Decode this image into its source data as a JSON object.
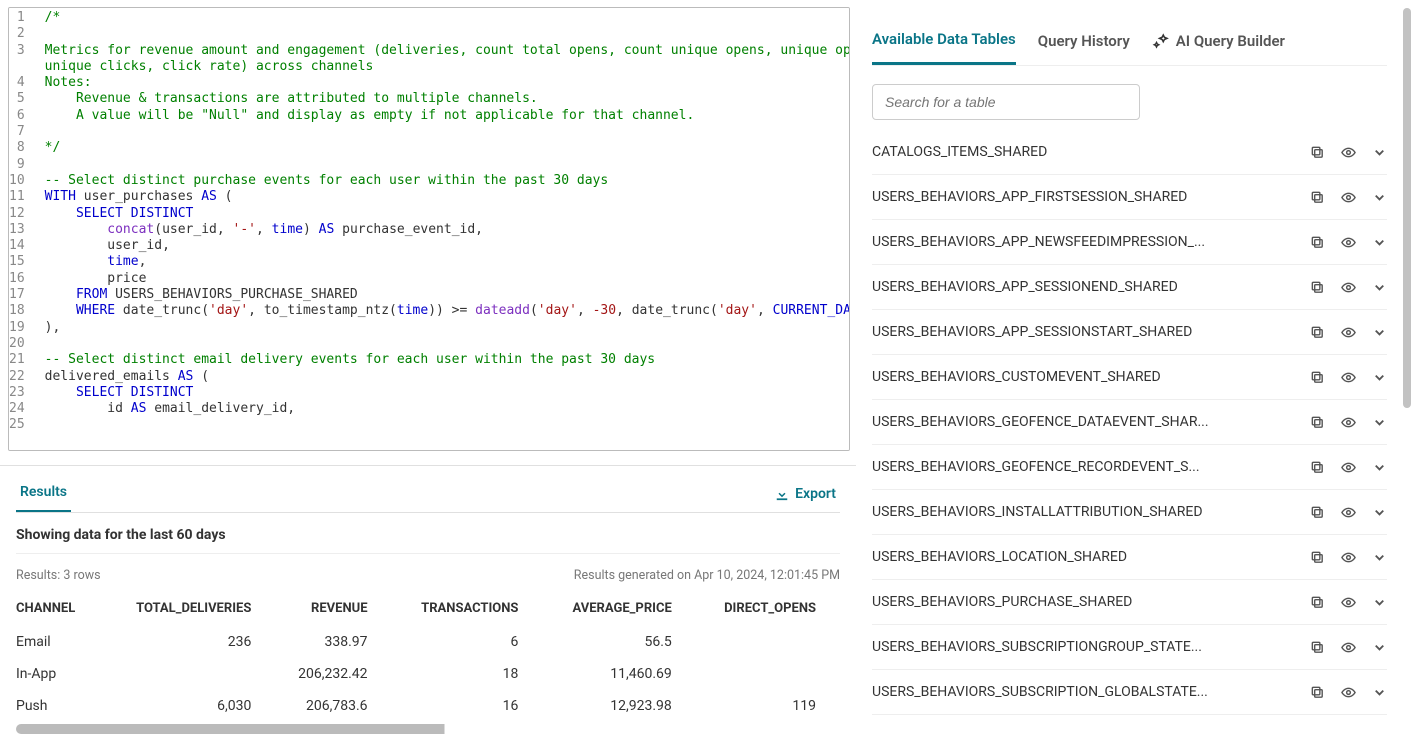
{
  "editor": {
    "lines": [
      {
        "n": 1,
        "segs": [
          {
            "t": "/*",
            "c": "c-comment"
          }
        ]
      },
      {
        "n": 2,
        "segs": []
      },
      {
        "n": 3,
        "segs": [
          {
            "t": "Metrics for revenue amount and engagement (deliveries, count total opens, count unique opens, unique open rate, count ",
            "c": "c-comment"
          }
        ]
      },
      {
        "n": 4,
        "indent": 0,
        "segs": [
          {
            "t": "unique clicks, click rate) across channels",
            "c": "c-comment"
          }
        ]
      },
      {
        "n": 5,
        "segs": [
          {
            "t": "Notes:",
            "c": "c-comment"
          }
        ]
      },
      {
        "n": 6,
        "indent": 1,
        "segs": [
          {
            "t": "Revenue & transactions are attributed to multiple channels.",
            "c": "c-comment"
          }
        ]
      },
      {
        "n": 7,
        "indent": 1,
        "segs": [
          {
            "t": "A value will be \"Null\" and display as empty if not applicable for that channel.",
            "c": "c-comment"
          }
        ]
      },
      {
        "n": 8,
        "segs": []
      },
      {
        "n": 9,
        "segs": [
          {
            "t": "*/",
            "c": "c-comment"
          }
        ]
      },
      {
        "n": 10,
        "segs": []
      },
      {
        "n": 11,
        "segs": [
          {
            "t": "-- Select distinct purchase events for each user within the past 30 days",
            "c": "c-comment"
          }
        ]
      },
      {
        "n": 12,
        "segs": [
          {
            "t": "WITH",
            "c": "c-kw"
          },
          {
            "t": " user_purchases ",
            "c": ""
          },
          {
            "t": "AS",
            "c": "c-kw"
          },
          {
            "t": " (",
            "c": ""
          }
        ]
      },
      {
        "n": 13,
        "indent": 1,
        "segs": [
          {
            "t": "SELECT DISTINCT",
            "c": "c-kw"
          }
        ]
      },
      {
        "n": 14,
        "indent": 2,
        "segs": [
          {
            "t": "concat",
            "c": "c-func"
          },
          {
            "t": "(user_id, ",
            "c": ""
          },
          {
            "t": "'-'",
            "c": "c-str"
          },
          {
            "t": ", ",
            "c": ""
          },
          {
            "t": "time",
            "c": "c-kw"
          },
          {
            "t": ") ",
            "c": ""
          },
          {
            "t": "AS",
            "c": "c-kw"
          },
          {
            "t": " purchase_event_id,",
            "c": ""
          }
        ]
      },
      {
        "n": 15,
        "indent": 2,
        "segs": [
          {
            "t": "user_id,",
            "c": ""
          }
        ]
      },
      {
        "n": 16,
        "indent": 2,
        "segs": [
          {
            "t": "time",
            "c": "c-kw"
          },
          {
            "t": ",",
            "c": ""
          }
        ]
      },
      {
        "n": 17,
        "indent": 2,
        "segs": [
          {
            "t": "price",
            "c": ""
          }
        ]
      },
      {
        "n": 18,
        "indent": 1,
        "segs": [
          {
            "t": "FROM",
            "c": "c-kw"
          },
          {
            "t": " USERS_BEHAVIORS_PURCHASE_SHARED",
            "c": ""
          }
        ]
      },
      {
        "n": 19,
        "indent": 1,
        "segs": [
          {
            "t": "WHERE",
            "c": "c-kw"
          },
          {
            "t": " date_trunc(",
            "c": ""
          },
          {
            "t": "'day'",
            "c": "c-str"
          },
          {
            "t": ", to_timestamp_ntz(",
            "c": ""
          },
          {
            "t": "time",
            "c": "c-kw"
          },
          {
            "t": ")) >= ",
            "c": ""
          },
          {
            "t": "dateadd",
            "c": "c-func"
          },
          {
            "t": "(",
            "c": ""
          },
          {
            "t": "'day'",
            "c": "c-str"
          },
          {
            "t": ", ",
            "c": ""
          },
          {
            "t": "-30",
            "c": "c-num"
          },
          {
            "t": ", date_trunc(",
            "c": ""
          },
          {
            "t": "'day'",
            "c": "c-str"
          },
          {
            "t": ", ",
            "c": ""
          },
          {
            "t": "CURRENT_DATE",
            "c": "c-kw"
          },
          {
            "t": "()))",
            "c": ""
          }
        ]
      },
      {
        "n": 20,
        "segs": [
          {
            "t": "),",
            "c": ""
          }
        ]
      },
      {
        "n": 21,
        "segs": []
      },
      {
        "n": 22,
        "segs": [
          {
            "t": "-- Select distinct email delivery events for each user within the past 30 days",
            "c": "c-comment"
          }
        ]
      },
      {
        "n": 23,
        "segs": [
          {
            "t": "delivered_emails ",
            "c": ""
          },
          {
            "t": "AS",
            "c": "c-kw"
          },
          {
            "t": " (",
            "c": ""
          }
        ]
      },
      {
        "n": 24,
        "indent": 1,
        "segs": [
          {
            "t": "SELECT DISTINCT",
            "c": "c-kw"
          }
        ]
      },
      {
        "n": 25,
        "indent": 2,
        "segs": [
          {
            "t": "id ",
            "c": ""
          },
          {
            "t": "AS",
            "c": "c-kw"
          },
          {
            "t": " email_delivery_id,",
            "c": ""
          }
        ]
      }
    ],
    "display_numbers": [
      1,
      2,
      3,
      "",
      4,
      5,
      6,
      7,
      8,
      9,
      10,
      11,
      12,
      13,
      14,
      15,
      16,
      17,
      18,
      19,
      20,
      21,
      22,
      23,
      24,
      25
    ]
  },
  "results": {
    "tab_label": "Results",
    "export_label": "Export",
    "subtitle": "Showing data for the last 60 days",
    "count_label": "Results: 3 rows",
    "generated_label": "Results generated on Apr 10, 2024, 12:01:45 PM",
    "columns": [
      "CHANNEL",
      "TOTAL_DELIVERIES",
      "REVENUE",
      "TRANSACTIONS",
      "AVERAGE_PRICE",
      "DIRECT_OPENS"
    ],
    "rows": [
      {
        "CHANNEL": "Email",
        "TOTAL_DELIVERIES": "236",
        "REVENUE": "338.97",
        "TRANSACTIONS": "6",
        "AVERAGE_PRICE": "56.5",
        "DIRECT_OPENS": ""
      },
      {
        "CHANNEL": "In-App",
        "TOTAL_DELIVERIES": "",
        "REVENUE": "206,232.42",
        "TRANSACTIONS": "18",
        "AVERAGE_PRICE": "11,460.69",
        "DIRECT_OPENS": ""
      },
      {
        "CHANNEL": "Push",
        "TOTAL_DELIVERIES": "6,030",
        "REVENUE": "206,783.6",
        "TRANSACTIONS": "16",
        "AVERAGE_PRICE": "12,923.98",
        "DIRECT_OPENS": "119"
      }
    ]
  },
  "sidebar": {
    "tabs": {
      "available": "Available Data Tables",
      "history": "Query History",
      "ai": "AI Query Builder"
    },
    "search_placeholder": "Search for a table",
    "tables": [
      "CATALOGS_ITEMS_SHARED",
      "USERS_BEHAVIORS_APP_FIRSTSESSION_SHARED",
      "USERS_BEHAVIORS_APP_NEWSFEEDIMPRESSION_...",
      "USERS_BEHAVIORS_APP_SESSIONEND_SHARED",
      "USERS_BEHAVIORS_APP_SESSIONSTART_SHARED",
      "USERS_BEHAVIORS_CUSTOMEVENT_SHARED",
      "USERS_BEHAVIORS_GEOFENCE_DATAEVENT_SHAR...",
      "USERS_BEHAVIORS_GEOFENCE_RECORDEVENT_S...",
      "USERS_BEHAVIORS_INSTALLATTRIBUTION_SHARED",
      "USERS_BEHAVIORS_LOCATION_SHARED",
      "USERS_BEHAVIORS_PURCHASE_SHARED",
      "USERS_BEHAVIORS_SUBSCRIPTIONGROUP_STATE...",
      "USERS_BEHAVIORS_SUBSCRIPTION_GLOBALSTATE..."
    ]
  }
}
